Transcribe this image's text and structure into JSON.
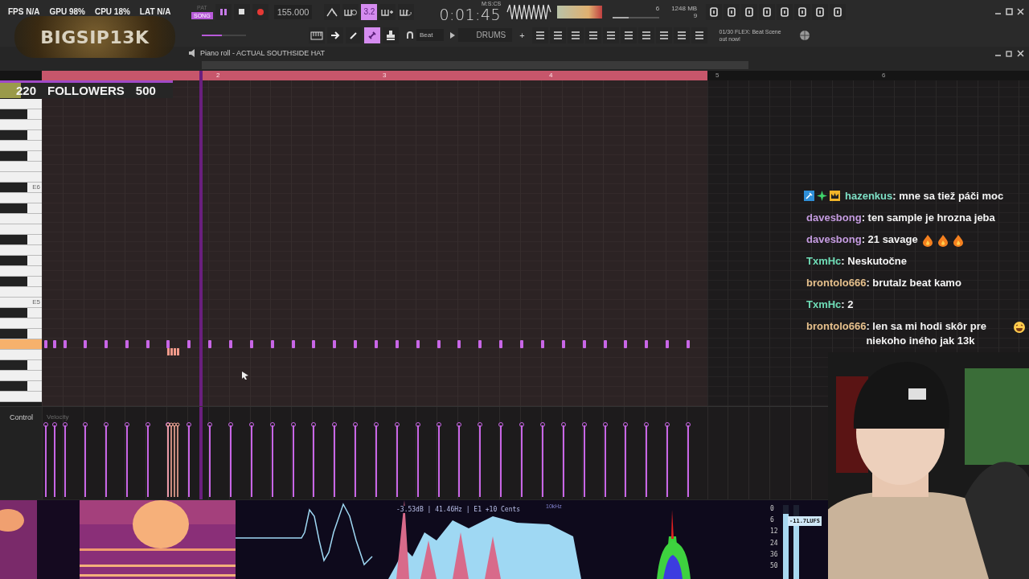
{
  "overlay": {
    "logo": "BIGSIP13K",
    "followers": {
      "current": "220",
      "label": "FOLLOWERS",
      "goal": "500"
    }
  },
  "toolbar": {
    "stats": [
      "FPS N/A",
      "GPU 98%",
      "CPU 18%",
      "LAT N/A"
    ],
    "mode": [
      {
        "label": "PAT",
        "selected": false
      },
      {
        "label": "SONG",
        "selected": true
      }
    ],
    "tempo": "155.000",
    "time_unit": "M:S:CS",
    "time": "0:01:45",
    "snap_value": "3.2",
    "voices": "6",
    "memory": "1248 MB",
    "cpu_cores": "9",
    "pitch": {
      "level": 0.45
    },
    "snap": "Beat",
    "channel": "DRUMS",
    "plus": "+",
    "news": "01/30 FLEX: Beat Scene out now!",
    "master_volume": {
      "level": 0.35
    }
  },
  "piano_roll": {
    "title": "Piano roll - ACTUAL SOUTHSIDE HAT",
    "bars": [
      {
        "selected": true
      },
      {
        "label": "2",
        "selected": true
      },
      {
        "label": "3",
        "selected": true
      },
      {
        "label": "4",
        "selected": true
      },
      {
        "label": "5",
        "selected": false
      },
      {
        "label": "6",
        "selected": false
      }
    ],
    "key_labels": [
      "E6",
      "E5"
    ],
    "control_label": "Control",
    "control_target": "Velocity"
  },
  "visualizers": {
    "spectrum_readout": "-3.53dB | 41.46Hz | E1 +10 Cents",
    "freq_label": "10kHz",
    "meter_scale": [
      "0",
      "6",
      "12",
      "24",
      "36",
      "50"
    ],
    "loudness": "-11.7LUFS",
    "meters": [
      {
        "level": 0.88
      },
      {
        "level": 0.82
      }
    ]
  },
  "chat": [
    {
      "kind": "badged",
      "user": "hazenkus",
      "color": "#7ee0c6",
      "text": ": mne sa tiež páči moc"
    },
    {
      "kind": "plain",
      "user": "davesbong",
      "color": "#c49be0",
      "text": ": ten sample je hrozna jeba"
    },
    {
      "kind": "fire",
      "user": "davesbong",
      "color": "#c49be0",
      "text": ": 21 savage"
    },
    {
      "kind": "plain",
      "user": "TxmHc",
      "color": "#6fdcb6",
      "text": ": Neskutočne"
    },
    {
      "kind": "plain",
      "user": "brontolo666",
      "color": "#e6c08c",
      "text": ": brutalz beat kamo"
    },
    {
      "kind": "plain",
      "user": "TxmHc",
      "color": "#6fdcb6",
      "text": ": 2"
    },
    {
      "kind": "laugh",
      "user": "brontolo666",
      "color": "#e6c08c",
      "text": ": len sa mi hodi skôr pre niekoho iného jak 13k"
    }
  ]
}
